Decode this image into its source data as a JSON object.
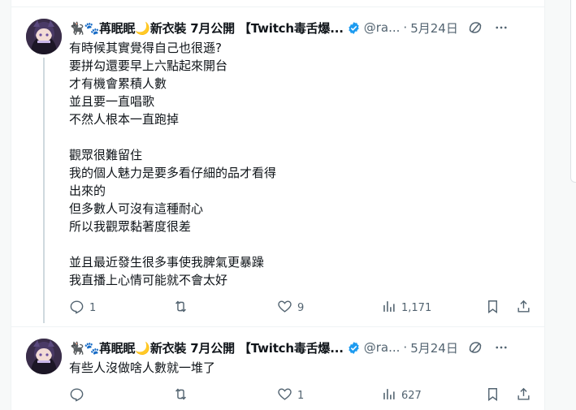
{
  "tweets": [
    {
      "display_name": "🐈‍⬛🐾苒眠眠🌙新衣裝 7月公開 【Twitch毒舌爆...",
      "handle": "@ra...",
      "separator": "·",
      "date": "5月24日",
      "text": "有時候其實覺得自己也很遜?\n要拼勾還要早上六點起來開台\n才有機會累積人數\n並且要一直唱歌\n不然人根本一直跑掉\n\n觀眾很難留住\n我的個人魅力是要多看仔細的品才看得\n出來的\n但多數人可沒有這種耐心\n所以我觀眾黏著度很差\n\n並且最近發生很多事使我脾氣更暴躁\n我直播上心情可能就不會太好",
      "replies": "1",
      "retweets": "",
      "likes": "9",
      "views": "1,171"
    },
    {
      "display_name": "🐈‍⬛🐾苒眠眠🌙新衣裝 7月公開 【Twitch毒舌爆...",
      "handle": "@ra...",
      "separator": "·",
      "date": "5月24日",
      "text": "有些人沒做啥人數就一堆了",
      "replies": "",
      "retweets": "",
      "likes": "1",
      "views": "627"
    }
  ],
  "colors": {
    "text": "#0f1419",
    "muted": "#536471",
    "verified": "#1d9bf0",
    "thread_line": "#cfd9de"
  },
  "icons": [
    "verified-badge-icon",
    "grok-icon",
    "more-icon",
    "reply-icon",
    "retweet-icon",
    "like-icon",
    "views-icon",
    "bookmark-icon",
    "share-icon"
  ]
}
